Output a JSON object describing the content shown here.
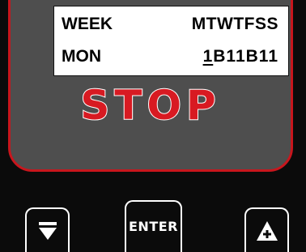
{
  "lcd": {
    "week_label": "WEEK",
    "days_header": "MTWTFSS",
    "day_label": "MON",
    "schedule_cursor": "1",
    "schedule_rest": "B11B11"
  },
  "status": {
    "text": "STOP",
    "color": "#d81a22"
  },
  "buttons": {
    "down": {
      "icon": "down-arrow-icon"
    },
    "enter": {
      "label": "ENTER"
    },
    "up": {
      "icon": "up-arrow-plus-icon"
    }
  },
  "colors": {
    "panel": "#4e4e4e",
    "panel_border": "#c8161d",
    "device_body": "#0b0b0b",
    "lcd_background": "#ffffff"
  }
}
